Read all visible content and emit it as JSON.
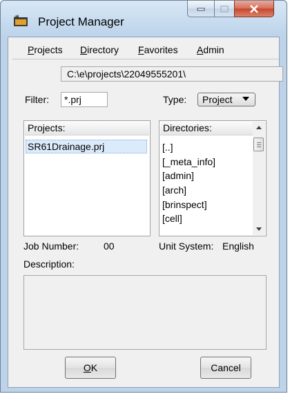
{
  "window": {
    "title": "Project Manager",
    "app_icon": "folder-icon"
  },
  "menu": {
    "projects": {
      "label_prefix": "",
      "mnemonic": "P",
      "label_rest": "rojects"
    },
    "directory": {
      "mnemonic": "D",
      "label_rest": "irectory"
    },
    "favorites": {
      "mnemonic": "F",
      "label_rest": "avorites"
    },
    "admin": {
      "mnemonic": "A",
      "label_rest": "dmin"
    }
  },
  "path": "C:\\e\\projects\\22049555201\\",
  "filter": {
    "label": "Filter:",
    "value": "*.prj"
  },
  "type": {
    "label": "Type:",
    "value": "Project"
  },
  "projects_panel": {
    "header": "Projects:",
    "items": [
      "SR61Drainage.prj"
    ]
  },
  "directories_panel": {
    "header": "Directories:",
    "items": [
      "[..]",
      "[_meta_info]",
      "[admin]",
      "[arch]",
      "[brinspect]",
      "[cell]"
    ]
  },
  "job_number": {
    "label": "Job Number:",
    "value": "00"
  },
  "unit_system": {
    "label": "Unit System:",
    "value": "English"
  },
  "description": {
    "label": "Description:"
  },
  "buttons": {
    "ok_mnemonic": "O",
    "ok_rest": "K",
    "cancel": "Cancel"
  }
}
